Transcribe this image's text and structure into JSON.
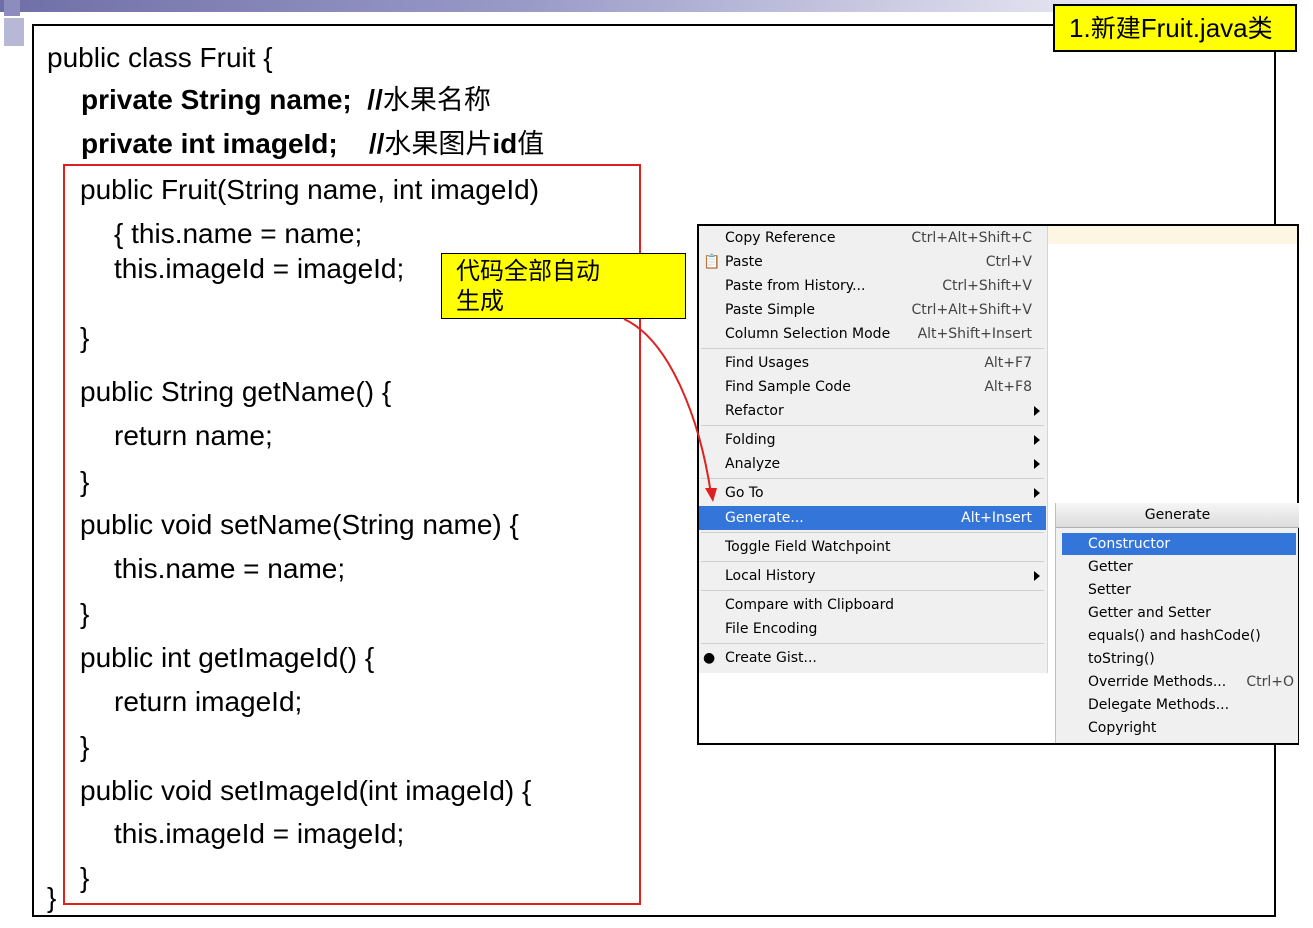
{
  "title_note": {
    "prefix": "1.",
    "cjk": "新建",
    "suffix": "Fruit.java",
    "cjk2": "类"
  },
  "code": {
    "class_decl": "public class Fruit {",
    "field_name": "private String name;",
    "field_name_comment_slash": "//",
    "field_name_comment": "水果名称",
    "field_image": "private int imageId;",
    "field_image_comment_slash": "//",
    "field_image_comment_a": "水果图片",
    "field_image_comment_b": "id",
    "field_image_comment_c": "值",
    "ctor_sig": "public Fruit(String name, int imageId)",
    "ctor_body1": "{ this.name = name;",
    "ctor_body2": "this.imageId = imageId;",
    "close1": "}",
    "getname_sig": "public String getName() {",
    "getname_body": "return name;",
    "close2": "}",
    "setname_sig": "public void setName(String name) {",
    "setname_body": "this.name = name;",
    "close3": "}",
    "getimage_sig": "public int getImageId() {",
    "getimage_body": "return imageId;",
    "close4": "}",
    "setimage_sig": "public void setImageId(int imageId) {",
    "setimage_body": "this.imageId = imageId;",
    "close5": "}",
    "class_close": "}"
  },
  "callout": {
    "line1": "代码全部自动",
    "line2": "生成"
  },
  "context_menu": {
    "items": [
      {
        "label": "Copy Reference",
        "shortcut": "Ctrl+Alt+Shift+C"
      },
      {
        "label": "Paste",
        "shortcut": "Ctrl+V",
        "icon": "clipboard-icon"
      },
      {
        "label": "Paste from History...",
        "shortcut": "Ctrl+Shift+V"
      },
      {
        "label": "Paste Simple",
        "shortcut": "Ctrl+Alt+Shift+V"
      },
      {
        "label": "Column Selection Mode",
        "shortcut": "Alt+Shift+Insert"
      },
      {
        "label": "Find Usages",
        "shortcut": "Alt+F7"
      },
      {
        "label": "Find Sample Code",
        "shortcut": "Alt+F8"
      },
      {
        "label": "Refactor",
        "submenu": true
      },
      {
        "label": "Folding",
        "submenu": true
      },
      {
        "label": "Analyze",
        "submenu": true
      },
      {
        "label": "Go To",
        "submenu": true
      },
      {
        "label": "Generate...",
        "shortcut": "Alt+Insert",
        "selected": true
      },
      {
        "label": "Toggle Field Watchpoint"
      },
      {
        "label": "Local History",
        "submenu": true
      },
      {
        "label": "Compare with Clipboard"
      },
      {
        "label": "File Encoding"
      },
      {
        "label": "Create Gist...",
        "icon": "github-icon"
      }
    ]
  },
  "generate_menu": {
    "title": "Generate",
    "items": [
      {
        "label": "Constructor",
        "selected": true
      },
      {
        "label": "Getter"
      },
      {
        "label": "Setter"
      },
      {
        "label": "Getter and Setter"
      },
      {
        "label": "equals() and hashCode()"
      },
      {
        "label": "toString()"
      },
      {
        "label": "Override Methods...",
        "shortcut": "Ctrl+O"
      },
      {
        "label": "Delegate Methods..."
      },
      {
        "label": "Copyright"
      }
    ]
  },
  "colors": {
    "selection": "#3475d9",
    "callout_bg": "#ffff00",
    "frame_red": "#e02020"
  }
}
